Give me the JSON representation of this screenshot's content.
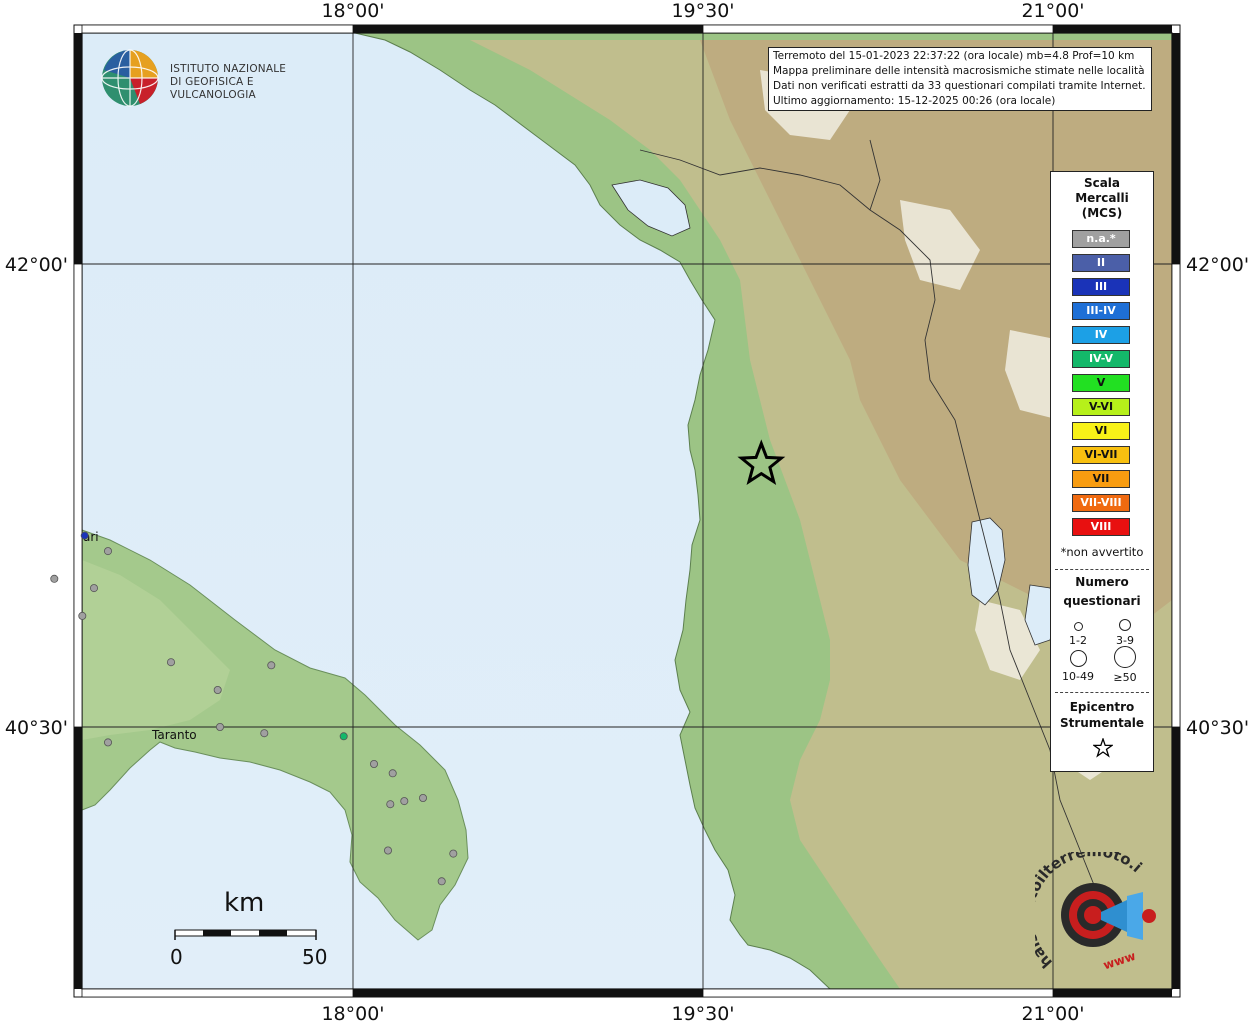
{
  "info": {
    "line1": "Terremoto del 15-01-2023 22:37:22 (ora locale) mb=4.8 Prof=10 km",
    "line2": "Mappa preliminare delle intensità macrosismiche stimate nelle località",
    "line3": "Dati non verificati estratti da 33 questionari compilati tramite Internet.",
    "line4": "Ultimo aggiornamento: 15-12-2025 00:26 (ora locale)"
  },
  "axes": {
    "top": [
      "18°00'",
      "19°30'",
      "21°00'"
    ],
    "bottom": [
      "18°00'",
      "19°30'",
      "21°00'"
    ],
    "left": [
      "42°00'",
      "40°30'"
    ],
    "right": [
      "42°00'",
      "40°30'"
    ]
  },
  "logo_ingv": {
    "line1": "ISTITUTO NAZIONALE",
    "line2": "DI GEOFISICA E VULCANOLOGIA"
  },
  "places": {
    "taranto": "Taranto",
    "bari_fragment": "ari"
  },
  "legend": {
    "title1": "Scala",
    "title2": "Mercalli",
    "title3": "(MCS)",
    "classes": [
      {
        "label": "n.a.*",
        "color": "#a0a0a0"
      },
      {
        "label": "II",
        "color": "#4b5fa8"
      },
      {
        "label": "III",
        "color": "#1a33b8"
      },
      {
        "label": "III-IV",
        "color": "#1e6fd6"
      },
      {
        "label": "IV",
        "color": "#1ca0e6"
      },
      {
        "label": "IV-V",
        "color": "#14b86a"
      },
      {
        "label": "V",
        "color": "#22e022"
      },
      {
        "label": "V-VI",
        "color": "#b6f01a"
      },
      {
        "label": "VI",
        "color": "#f8f218"
      },
      {
        "label": "VI-VII",
        "color": "#f8c010"
      },
      {
        "label": "VII",
        "color": "#f89c10"
      },
      {
        "label": "VII-VIII",
        "color": "#f06a10"
      },
      {
        "label": "VIII",
        "color": "#e81010"
      }
    ],
    "note": "*non avvertito",
    "count_title1": "Numero",
    "count_title2": "questionari",
    "counts": [
      "1-2",
      "3-9",
      "10-49",
      "≥50"
    ],
    "epi_title1": "Epicentro",
    "epi_title2": "Strumentale"
  },
  "scalebar": {
    "unit": "km",
    "start": "0",
    "end": "50"
  },
  "logo_hsit": {
    "text": "haisentitoilterremoto.it",
    "url_text": "www"
  },
  "points": [
    {
      "lon": 16.85,
      "lat": 41.12,
      "color": "#1a33b8"
    },
    {
      "lon": 16.95,
      "lat": 41.07,
      "color": "#a0a0a0"
    },
    {
      "lon": 16.72,
      "lat": 40.98,
      "color": "#a0a0a0"
    },
    {
      "lon": 16.89,
      "lat": 40.95,
      "color": "#a0a0a0"
    },
    {
      "lon": 16.84,
      "lat": 40.86,
      "color": "#a0a0a0"
    },
    {
      "lon": 17.22,
      "lat": 40.71,
      "color": "#a0a0a0"
    },
    {
      "lon": 17.42,
      "lat": 40.62,
      "color": "#a0a0a0"
    },
    {
      "lon": 17.43,
      "lat": 40.5,
      "color": "#a0a0a0"
    },
    {
      "lon": 17.62,
      "lat": 40.48,
      "color": "#a0a0a0"
    },
    {
      "lon": 17.65,
      "lat": 40.7,
      "color": "#a0a0a0"
    },
    {
      "lon": 17.96,
      "lat": 40.47,
      "color": "#14b86a"
    },
    {
      "lon": 16.95,
      "lat": 40.45,
      "color": "#a0a0a0"
    },
    {
      "lon": 18.09,
      "lat": 40.38,
      "color": "#a0a0a0"
    },
    {
      "lon": 18.17,
      "lat": 40.35,
      "color": "#a0a0a0"
    },
    {
      "lon": 18.16,
      "lat": 40.25,
      "color": "#a0a0a0"
    },
    {
      "lon": 18.22,
      "lat": 40.26,
      "color": "#a0a0a0"
    },
    {
      "lon": 18.3,
      "lat": 40.27,
      "color": "#a0a0a0"
    },
    {
      "lon": 18.15,
      "lat": 40.1,
      "color": "#a0a0a0"
    },
    {
      "lon": 18.43,
      "lat": 40.09,
      "color": "#a0a0a0"
    },
    {
      "lon": 18.38,
      "lat": 40.0,
      "color": "#a0a0a0"
    }
  ],
  "epicenter": {
    "lon": 19.75,
    "lat": 41.35
  }
}
